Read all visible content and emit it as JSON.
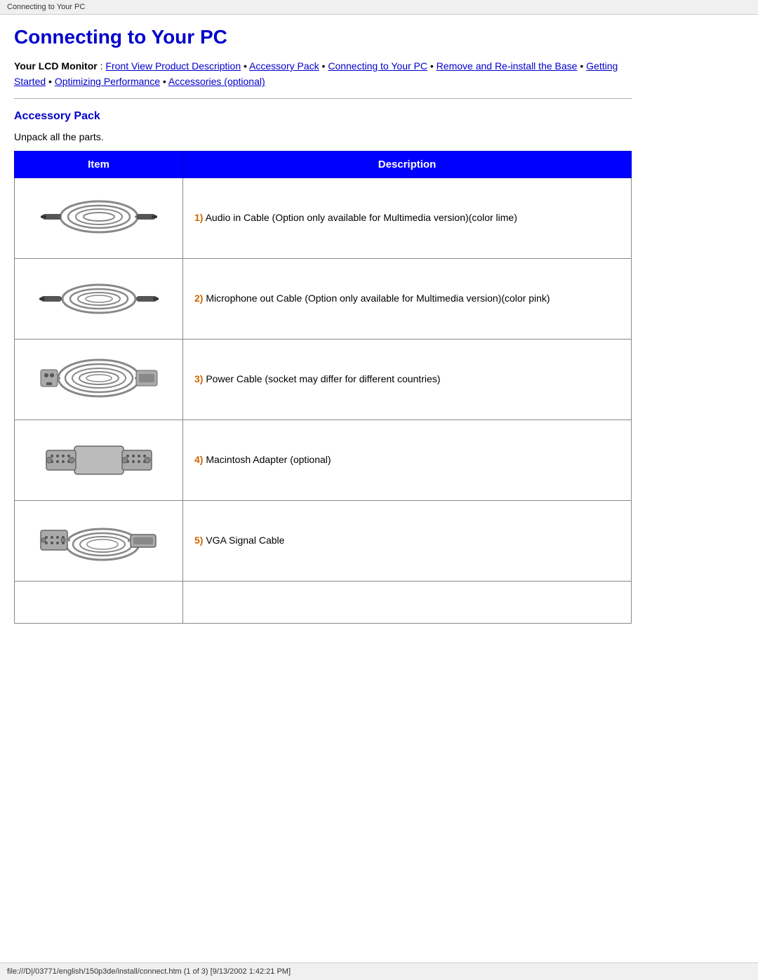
{
  "browser_bar": "Connecting to Your PC",
  "status_bar": "file:///D|/03771/english/150p3de/install/connect.htm (1 of 3) [9/13/2002 1:42:21 PM]",
  "page_title": "Connecting to Your PC",
  "nav": {
    "label": "Your LCD Monitor",
    "links": [
      {
        "text": "Front View Product Description",
        "href": "#"
      },
      {
        "text": "Accessory Pack",
        "href": "#"
      },
      {
        "text": "Connecting to Your PC",
        "href": "#"
      },
      {
        "text": "Remove and Re-install the Base",
        "href": "#"
      },
      {
        "text": "Getting Started",
        "href": "#"
      },
      {
        "text": "Optimizing Performance",
        "href": "#"
      },
      {
        "text": "Accessories (optional)",
        "href": "#"
      }
    ]
  },
  "section_title": "Accessory Pack",
  "unpack_text": "Unpack all the parts.",
  "table": {
    "col_item": "Item",
    "col_desc": "Description",
    "rows": [
      {
        "num": "1",
        "desc": "Audio in Cable (Option only available for Multimedia version)(color lime)"
      },
      {
        "num": "2",
        "desc": "Microphone out Cable (Option only available for Multimedia version)(color pink)"
      },
      {
        "num": "3",
        "desc": "Power Cable (socket may differ for different countries)"
      },
      {
        "num": "4",
        "desc": "Macintosh Adapter (optional)"
      },
      {
        "num": "5",
        "desc": "VGA Signal Cable"
      }
    ]
  }
}
